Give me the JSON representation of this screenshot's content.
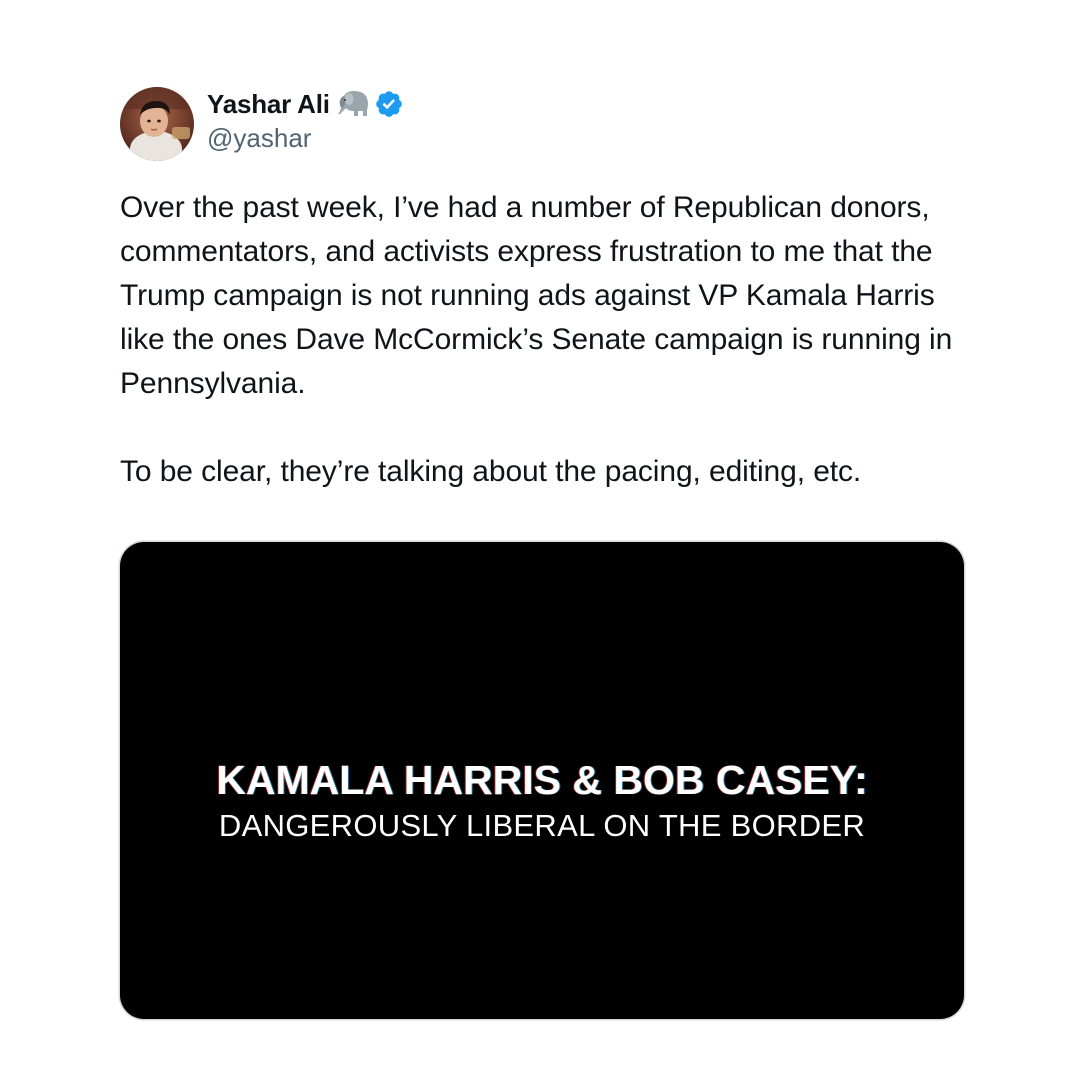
{
  "author": {
    "display_name": "Yashar Ali",
    "handle": "@yashar",
    "name_emoji": "elephant-icon",
    "verified_icon": "verified-badge-icon",
    "verified_color": "#1d9bf0"
  },
  "tweet": {
    "paragraphs": [
      "Over the past week, I’ve had a number of Republican donors, commentators, and activists express frustration to me that the Trump campaign is not running ads against VP Kamala Harris like the ones Dave McCormick’s Senate campaign is running in Pennsylvania.",
      "To be clear, they’re talking about the pacing, editing, etc."
    ]
  },
  "media": {
    "headline": "KAMALA HARRIS & BOB CASEY:",
    "subline": "DANGEROUSLY LIBERAL ON THE BORDER",
    "background": "#000000"
  },
  "colors": {
    "text_primary": "#0f1419",
    "text_secondary": "#536471",
    "page_background": "#ffffff"
  }
}
